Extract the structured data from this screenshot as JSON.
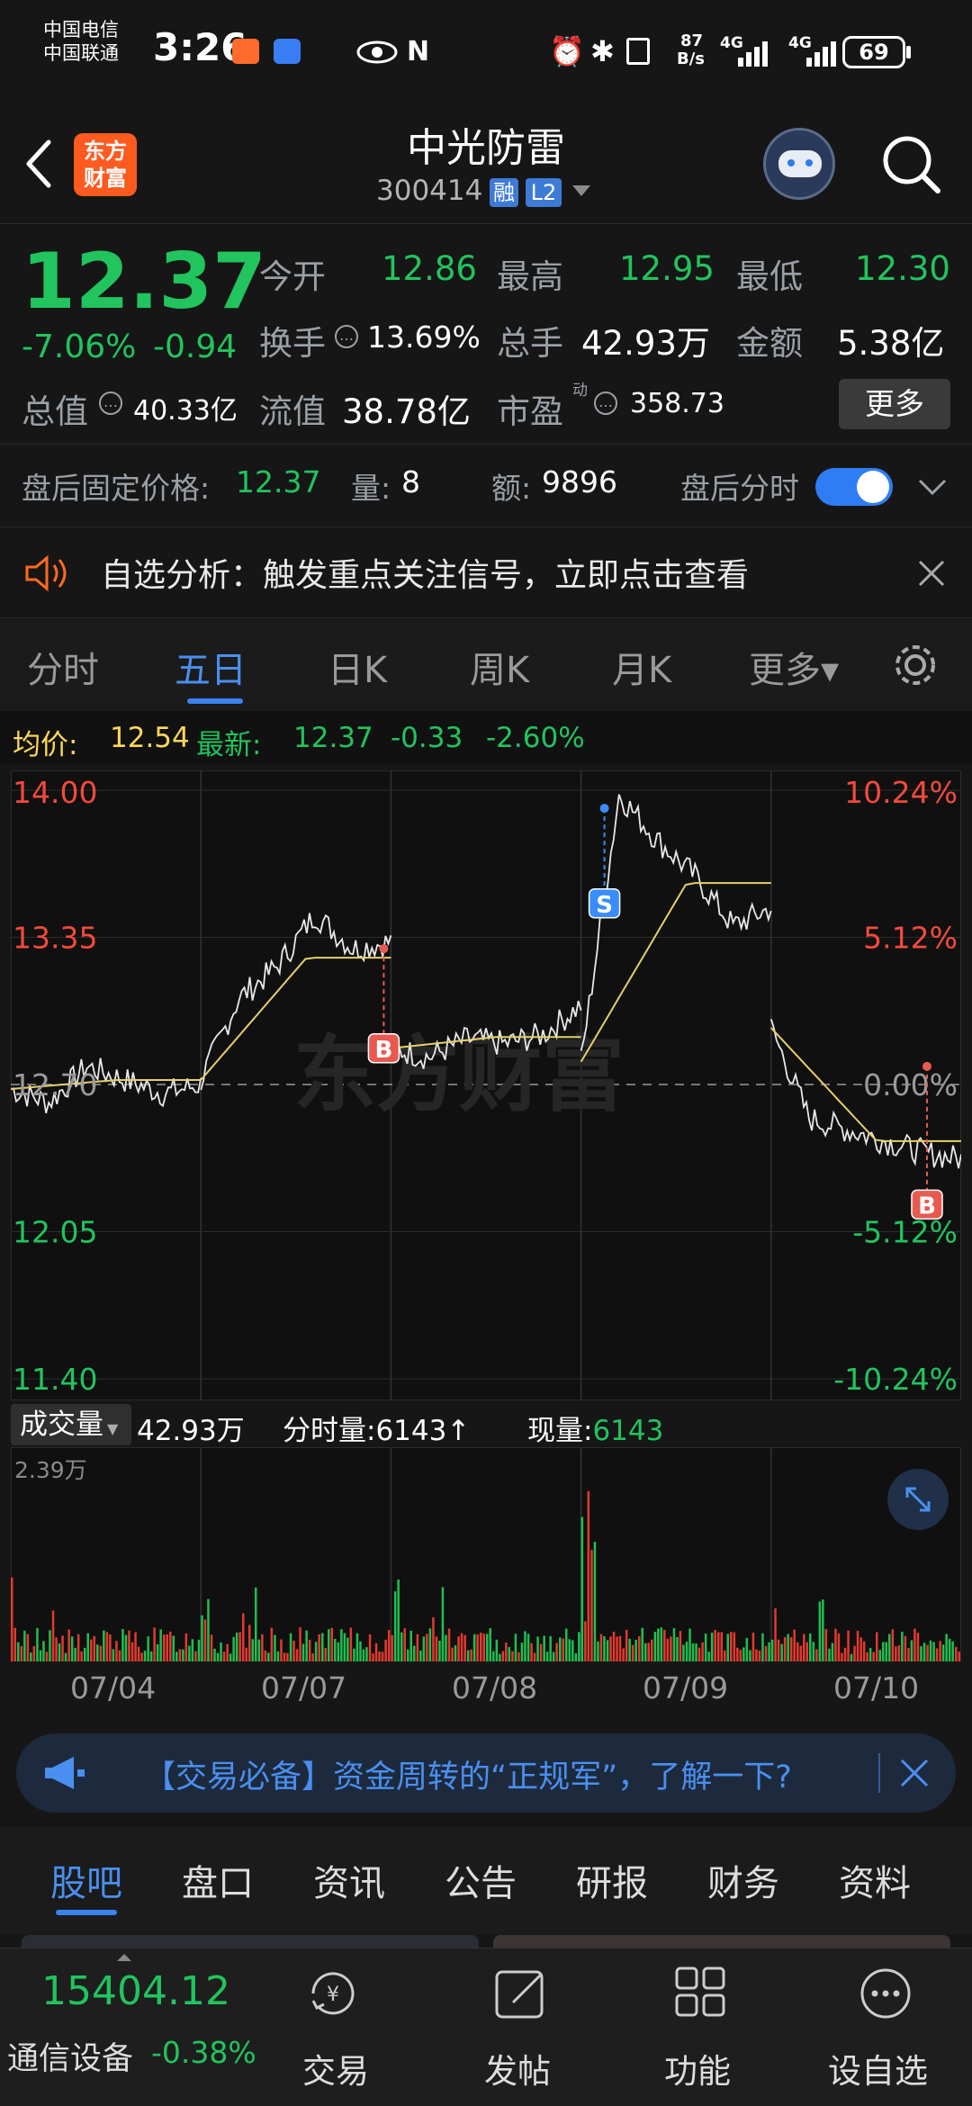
{
  "status": {
    "carrier1": "中国电信",
    "carrier2": "中国联通",
    "time": "3:26",
    "speed_top": "87",
    "speed_bottom": "B/s",
    "net1": "4G",
    "net2": "4G",
    "battery": "69"
  },
  "header": {
    "title": "中光防雷",
    "code": "300414",
    "badge_rong": "融",
    "badge_level": "L2",
    "logo_line1": "东方",
    "logo_line2": "财富"
  },
  "quote": {
    "price": "12.37",
    "change_pct": "-7.06%",
    "change": "-0.94",
    "labels": {
      "open": "今开",
      "high": "最高",
      "low": "最低",
      "turnover": "换手",
      "total_hand": "总手",
      "amount": "金额",
      "total_value": "总值",
      "float_value": "流值",
      "pe": "市盈",
      "pe_sup": "动",
      "more": "更多"
    },
    "values": {
      "open": "12.86",
      "high": "12.95",
      "low": "12.30",
      "turnover": "13.69%",
      "total_hand": "42.93万",
      "amount": "5.38亿",
      "total_value": "40.33亿",
      "float_value": "38.78亿",
      "pe": "358.73"
    }
  },
  "after": {
    "fixed_label": "盘后固定价格:",
    "fixed_value": "12.37",
    "vol_label": "量:",
    "vol_value": "8",
    "amt_label": "额:",
    "amt_value": "9896",
    "toggle_label": "盘后分时"
  },
  "notice": {
    "text": "自选分析：触发重点关注信号，立即点击查看"
  },
  "tabs": [
    "分时",
    "五日",
    "日K",
    "周K",
    "月K",
    "更多▾"
  ],
  "chart_info": {
    "avg_label": "均价:",
    "avg_value": "12.54",
    "latest_label": "最新:",
    "latest_value": "12.37",
    "chg": "-0.33",
    "chg_pct": "-2.60%"
  },
  "chart_data": {
    "type": "line",
    "x": [
      "07/04",
      "07/07",
      "07/08",
      "07/09",
      "07/10"
    ],
    "y_left": [
      "14.00",
      "13.35",
      "12.70",
      "12.05",
      "11.40"
    ],
    "y_right": [
      "10.24%",
      "5.12%",
      "0.00%",
      "-5.12%",
      "-10.24%"
    ],
    "ylim": [
      11.4,
      14.0
    ],
    "base": 12.7,
    "watermark": "东方财富",
    "markers": [
      {
        "label": "B",
        "day": "07/07"
      },
      {
        "label": "S",
        "day": "07/09"
      },
      {
        "label": "B",
        "day": "07/10"
      }
    ]
  },
  "volume": {
    "label": "成交量",
    "total": "42.93万",
    "minute_label": "分时量:",
    "minute_value": "6143",
    "arrow": "↑",
    "current_label": "现量:",
    "current_value": "6143",
    "max": "2.39万"
  },
  "ad": {
    "text": "【交易必备】资金周转的“正规军”，了解一下?"
  },
  "bottom_tabs": [
    "股吧",
    "盘口",
    "资讯",
    "公告",
    "研报",
    "财务",
    "资料"
  ],
  "footer": {
    "index_value": "15404.12",
    "index_name": "通信设备",
    "index_chg": "-0.38%",
    "nav": [
      "交易",
      "发帖",
      "功能",
      "设自选"
    ]
  }
}
